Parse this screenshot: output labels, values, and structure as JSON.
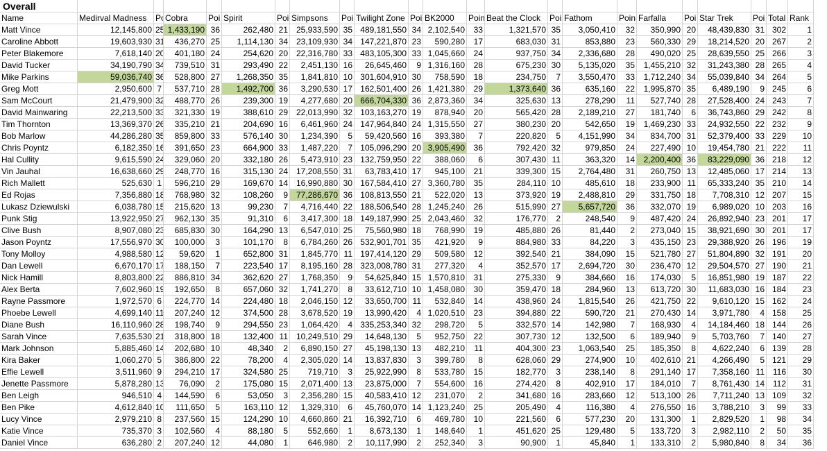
{
  "sheet_title": "Overall",
  "highlight_color": "#c4d79b",
  "headers": [
    "Name",
    "Medirval Madness",
    "Poi",
    "Cobra",
    "Poi",
    "Spirit",
    "Poi",
    "Simpsons",
    "Poi",
    "Twilight Zone",
    "Poi",
    "BK2000",
    "Poin",
    "Beat the Clock",
    "Poi",
    "Fathom",
    "Poin",
    "Farfalla",
    "Poi",
    "Star Trek",
    "Poi",
    "Total P",
    "Rank"
  ],
  "rows": [
    [
      "Matt Vince",
      "12,145,800",
      "25",
      "1,433,190",
      "36",
      "262,480",
      "21",
      "25,933,590",
      "35",
      "489,181,550",
      "34",
      "2,102,540",
      "33",
      "1,321,570",
      "35",
      "3,050,410",
      "32",
      "350,990",
      "20",
      "48,439,830",
      "31",
      "302",
      "1"
    ],
    [
      "Caroline Abbott",
      "19,603,930",
      "31",
      "436,270",
      "25",
      "1,114,130",
      "34",
      "23,109,930",
      "34",
      "147,221,870",
      "23",
      "590,280",
      "17",
      "683,030",
      "31",
      "853,880",
      "23",
      "560,330",
      "29",
      "18,214,520",
      "20",
      "267",
      "2"
    ],
    [
      "Peter Blakemore",
      "7,618,140",
      "20",
      "401,180",
      "24",
      "254,620",
      "20",
      "22,316,780",
      "33",
      "483,105,300",
      "33",
      "1,045,660",
      "24",
      "937,750",
      "34",
      "2,336,680",
      "28",
      "490,020",
      "25",
      "28,639,550",
      "25",
      "266",
      "3"
    ],
    [
      "David Tucker",
      "34,190,790",
      "34",
      "739,510",
      "31",
      "293,490",
      "22",
      "2,451,130",
      "16",
      "26,645,460",
      "9",
      "1,316,160",
      "28",
      "675,230",
      "30",
      "5,135,020",
      "35",
      "1,455,210",
      "32",
      "31,243,380",
      "28",
      "265",
      "4"
    ],
    [
      "Mike Parkins",
      "59,036,740",
      "36",
      "528,800",
      "27",
      "1,268,350",
      "35",
      "1,841,810",
      "10",
      "301,604,910",
      "30",
      "758,590",
      "18",
      "234,750",
      "7",
      "3,550,470",
      "33",
      "1,712,240",
      "34",
      "55,039,840",
      "34",
      "264",
      "5"
    ],
    [
      "Greg Mott",
      "2,950,600",
      "7",
      "537,710",
      "28",
      "1,492,700",
      "36",
      "3,290,530",
      "17",
      "162,501,400",
      "26",
      "1,421,380",
      "29",
      "1,373,640",
      "36",
      "635,160",
      "22",
      "1,995,870",
      "35",
      "6,489,190",
      "9",
      "245",
      "6"
    ],
    [
      "Sam McCourt",
      "21,479,900",
      "32",
      "488,770",
      "26",
      "239,300",
      "19",
      "4,277,680",
      "20",
      "666,704,330",
      "36",
      "2,873,360",
      "34",
      "325,630",
      "13",
      "278,290",
      "11",
      "527,740",
      "28",
      "27,528,400",
      "24",
      "243",
      "7"
    ],
    [
      "David Mainwaring",
      "22,213,500",
      "33",
      "321,330",
      "19",
      "388,610",
      "29",
      "22,013,990",
      "32",
      "103,163,270",
      "19",
      "878,940",
      "20",
      "565,420",
      "28",
      "2,189,210",
      "27",
      "181,740",
      "6",
      "36,743,860",
      "29",
      "242",
      "8"
    ],
    [
      "Tim Thornton",
      "13,369,370",
      "26",
      "335,210",
      "21",
      "204,690",
      "16",
      "6,461,960",
      "24",
      "147,964,840",
      "24",
      "1,315,550",
      "27",
      "380,230",
      "20",
      "542,650",
      "19",
      "1,469,230",
      "33",
      "24,932,550",
      "22",
      "232",
      "9"
    ],
    [
      "Bob Marlow",
      "44,286,280",
      "35",
      "859,800",
      "33",
      "576,140",
      "30",
      "1,234,390",
      "5",
      "59,420,560",
      "16",
      "393,380",
      "7",
      "220,820",
      "5",
      "4,151,990",
      "34",
      "834,700",
      "31",
      "52,379,400",
      "33",
      "229",
      "10"
    ],
    [
      "Chris Poyntz",
      "6,182,350",
      "16",
      "391,650",
      "23",
      "664,900",
      "33",
      "1,487,220",
      "7",
      "105,096,290",
      "20",
      "3,905,490",
      "36",
      "792,420",
      "32",
      "979,850",
      "24",
      "227,490",
      "10",
      "19,454,780",
      "21",
      "222",
      "11"
    ],
    [
      "Hal Cullity",
      "9,615,590",
      "24",
      "329,060",
      "20",
      "332,180",
      "26",
      "5,473,910",
      "23",
      "132,759,950",
      "22",
      "388,060",
      "6",
      "307,430",
      "11",
      "363,320",
      "14",
      "2,200,400",
      "36",
      "83,229,090",
      "36",
      "218",
      "12"
    ],
    [
      "Vin Jauhal",
      "16,638,660",
      "29",
      "248,770",
      "16",
      "315,130",
      "24",
      "17,208,550",
      "31",
      "63,783,410",
      "17",
      "945,100",
      "21",
      "339,300",
      "15",
      "2,764,480",
      "31",
      "260,750",
      "13",
      "12,485,060",
      "17",
      "214",
      "13"
    ],
    [
      "Rich Mallett",
      "525,630",
      "1",
      "596,210",
      "29",
      "169,670",
      "14",
      "16,990,880",
      "30",
      "167,584,410",
      "27",
      "3,360,780",
      "35",
      "284,110",
      "10",
      "485,610",
      "18",
      "233,900",
      "11",
      "65,333,240",
      "35",
      "210",
      "14"
    ],
    [
      "Ed Rojas",
      "7,356,880",
      "18",
      "768,980",
      "32",
      "108,260",
      "9",
      "77,286,670",
      "36",
      "108,813,550",
      "21",
      "522,020",
      "13",
      "373,920",
      "19",
      "2,488,810",
      "29",
      "331,750",
      "18",
      "7,708,310",
      "12",
      "207",
      "15"
    ],
    [
      "Lukasz Dziewulski",
      "6,038,780",
      "15",
      "215,620",
      "13",
      "99,230",
      "7",
      "4,716,440",
      "22",
      "188,506,540",
      "28",
      "1,245,240",
      "26",
      "515,990",
      "27",
      "5,657,720",
      "36",
      "332,070",
      "19",
      "6,989,020",
      "10",
      "203",
      "16"
    ],
    [
      "Punk Stig",
      "13,922,950",
      "27",
      "962,130",
      "35",
      "91,310",
      "6",
      "3,417,300",
      "18",
      "149,187,990",
      "25",
      "2,043,460",
      "32",
      "176,770",
      "2",
      "248,540",
      "9",
      "487,420",
      "24",
      "26,892,940",
      "23",
      "201",
      "17"
    ],
    [
      "Clive Bush",
      "8,907,080",
      "23",
      "685,830",
      "30",
      "164,290",
      "13",
      "6,547,010",
      "25",
      "75,560,980",
      "18",
      "768,990",
      "19",
      "485,880",
      "26",
      "81,440",
      "2",
      "273,040",
      "15",
      "38,921,690",
      "30",
      "201",
      "17"
    ],
    [
      "Jason Poyntz",
      "17,556,970",
      "30",
      "100,000",
      "3",
      "101,170",
      "8",
      "6,784,260",
      "26",
      "532,901,701",
      "35",
      "421,920",
      "9",
      "884,980",
      "33",
      "84,220",
      "3",
      "435,150",
      "23",
      "29,388,920",
      "26",
      "196",
      "19"
    ],
    [
      "Tony Molloy",
      "4,988,580",
      "12",
      "59,620",
      "1",
      "652,800",
      "31",
      "1,845,770",
      "11",
      "197,414,120",
      "29",
      "509,580",
      "12",
      "392,540",
      "21",
      "384,090",
      "15",
      "521,780",
      "27",
      "51,804,890",
      "32",
      "191",
      "20"
    ],
    [
      "Dan Lewell",
      "6,670,170",
      "17",
      "188,150",
      "7",
      "223,540",
      "17",
      "8,195,160",
      "28",
      "323,008,780",
      "31",
      "277,320",
      "4",
      "352,570",
      "17",
      "2,694,720",
      "30",
      "236,470",
      "12",
      "29,504,570",
      "27",
      "190",
      "21"
    ],
    [
      "Nick Hamill",
      "8,803,800",
      "22",
      "886,810",
      "34",
      "362,620",
      "27",
      "1,768,350",
      "9",
      "54,625,840",
      "15",
      "1,570,810",
      "31",
      "275,330",
      "9",
      "384,660",
      "16",
      "174,030",
      "5",
      "16,851,980",
      "19",
      "187",
      "22"
    ],
    [
      "Alex Berta",
      "7,602,960",
      "19",
      "192,650",
      "8",
      "657,060",
      "32",
      "1,741,270",
      "8",
      "33,612,710",
      "10",
      "1,458,080",
      "30",
      "359,470",
      "18",
      "284,960",
      "13",
      "613,720",
      "30",
      "11,683,030",
      "16",
      "184",
      "23"
    ],
    [
      "Rayne Passmore",
      "1,972,570",
      "6",
      "224,770",
      "14",
      "224,480",
      "18",
      "2,046,150",
      "12",
      "33,650,700",
      "11",
      "532,840",
      "14",
      "438,960",
      "24",
      "1,815,540",
      "26",
      "421,750",
      "22",
      "9,610,120",
      "15",
      "162",
      "24"
    ],
    [
      "Phoebe Lewell",
      "4,699,140",
      "11",
      "207,240",
      "12",
      "374,500",
      "28",
      "3,678,520",
      "19",
      "13,990,420",
      "4",
      "1,020,510",
      "23",
      "394,880",
      "22",
      "590,720",
      "21",
      "270,430",
      "14",
      "3,971,780",
      "4",
      "158",
      "25"
    ],
    [
      "Diane Bush",
      "16,110,960",
      "28",
      "198,740",
      "9",
      "294,550",
      "23",
      "1,064,420",
      "4",
      "335,253,340",
      "32",
      "298,720",
      "5",
      "332,570",
      "14",
      "142,980",
      "7",
      "168,930",
      "4",
      "14,184,460",
      "18",
      "144",
      "26"
    ],
    [
      "Sarah Vince",
      "7,635,530",
      "21",
      "318,800",
      "18",
      "132,400",
      "11",
      "10,249,510",
      "29",
      "14,648,130",
      "5",
      "952,750",
      "22",
      "307,730",
      "12",
      "132,500",
      "6",
      "189,940",
      "9",
      "5,703,760",
      "7",
      "140",
      "27"
    ],
    [
      "Mark Johnson",
      "5,885,460",
      "14",
      "202,680",
      "10",
      "48,340",
      "2",
      "6,890,150",
      "27",
      "45,198,130",
      "13",
      "482,210",
      "11",
      "404,300",
      "23",
      "1,063,540",
      "25",
      "185,350",
      "8",
      "4,622,240",
      "6",
      "139",
      "28"
    ],
    [
      "Kira Baker",
      "1,060,270",
      "5",
      "386,800",
      "22",
      "78,200",
      "4",
      "2,305,020",
      "14",
      "13,837,830",
      "3",
      "399,780",
      "8",
      "628,060",
      "29",
      "274,900",
      "10",
      "402,610",
      "21",
      "4,266,490",
      "5",
      "121",
      "29"
    ],
    [
      "Effie Lewell",
      "3,511,960",
      "9",
      "294,210",
      "17",
      "324,580",
      "25",
      "719,710",
      "3",
      "25,922,990",
      "8",
      "533,780",
      "15",
      "182,770",
      "3",
      "238,140",
      "8",
      "291,140",
      "17",
      "7,358,160",
      "11",
      "116",
      "30"
    ],
    [
      "Jenette Passmore",
      "5,878,280",
      "13",
      "76,090",
      "2",
      "175,080",
      "15",
      "2,071,400",
      "13",
      "23,875,000",
      "7",
      "554,600",
      "16",
      "274,420",
      "8",
      "402,910",
      "17",
      "184,010",
      "7",
      "8,761,430",
      "14",
      "112",
      "31"
    ],
    [
      "Ben Leigh",
      "946,510",
      "4",
      "144,590",
      "6",
      "53,050",
      "3",
      "2,356,280",
      "15",
      "40,583,410",
      "12",
      "231,070",
      "2",
      "341,680",
      "16",
      "283,660",
      "12",
      "513,100",
      "26",
      "7,711,240",
      "13",
      "109",
      "32"
    ],
    [
      "Ben Pike",
      "4,612,840",
      "10",
      "111,650",
      "5",
      "163,110",
      "12",
      "1,329,310",
      "6",
      "45,760,070",
      "14",
      "1,123,240",
      "25",
      "205,490",
      "4",
      "116,380",
      "4",
      "276,550",
      "16",
      "3,788,210",
      "3",
      "99",
      "33"
    ],
    [
      "Lucy Vince",
      "2,979,210",
      "8",
      "237,560",
      "15",
      "124,290",
      "10",
      "4,660,860",
      "21",
      "16,392,710",
      "6",
      "469,780",
      "10",
      "221,560",
      "6",
      "577,230",
      "20",
      "131,300",
      "1",
      "2,829,520",
      "1",
      "98",
      "34"
    ],
    [
      "Katie Vince",
      "735,370",
      "3",
      "102,560",
      "4",
      "88,180",
      "5",
      "552,660",
      "1",
      "8,673,130",
      "1",
      "148,640",
      "1",
      "451,620",
      "25",
      "129,480",
      "5",
      "133,720",
      "3",
      "2,982,110",
      "2",
      "50",
      "35"
    ],
    [
      "Daniel Vince",
      "636,280",
      "2",
      "207,240",
      "12",
      "44,080",
      "1",
      "646,980",
      "2",
      "10,117,990",
      "2",
      "252,340",
      "3",
      "90,900",
      "1",
      "45,840",
      "1",
      "133,310",
      "2",
      "5,980,840",
      "8",
      "34",
      "36"
    ]
  ],
  "highlighted_cells": [
    {
      "row": 0,
      "col": 3
    },
    {
      "row": 4,
      "col": 1
    },
    {
      "row": 5,
      "col": 5
    },
    {
      "row": 5,
      "col": 13
    },
    {
      "row": 6,
      "col": 9
    },
    {
      "row": 10,
      "col": 11
    },
    {
      "row": 11,
      "col": 17
    },
    {
      "row": 11,
      "col": 19
    },
    {
      "row": 14,
      "col": 7
    },
    {
      "row": 15,
      "col": 15
    }
  ]
}
